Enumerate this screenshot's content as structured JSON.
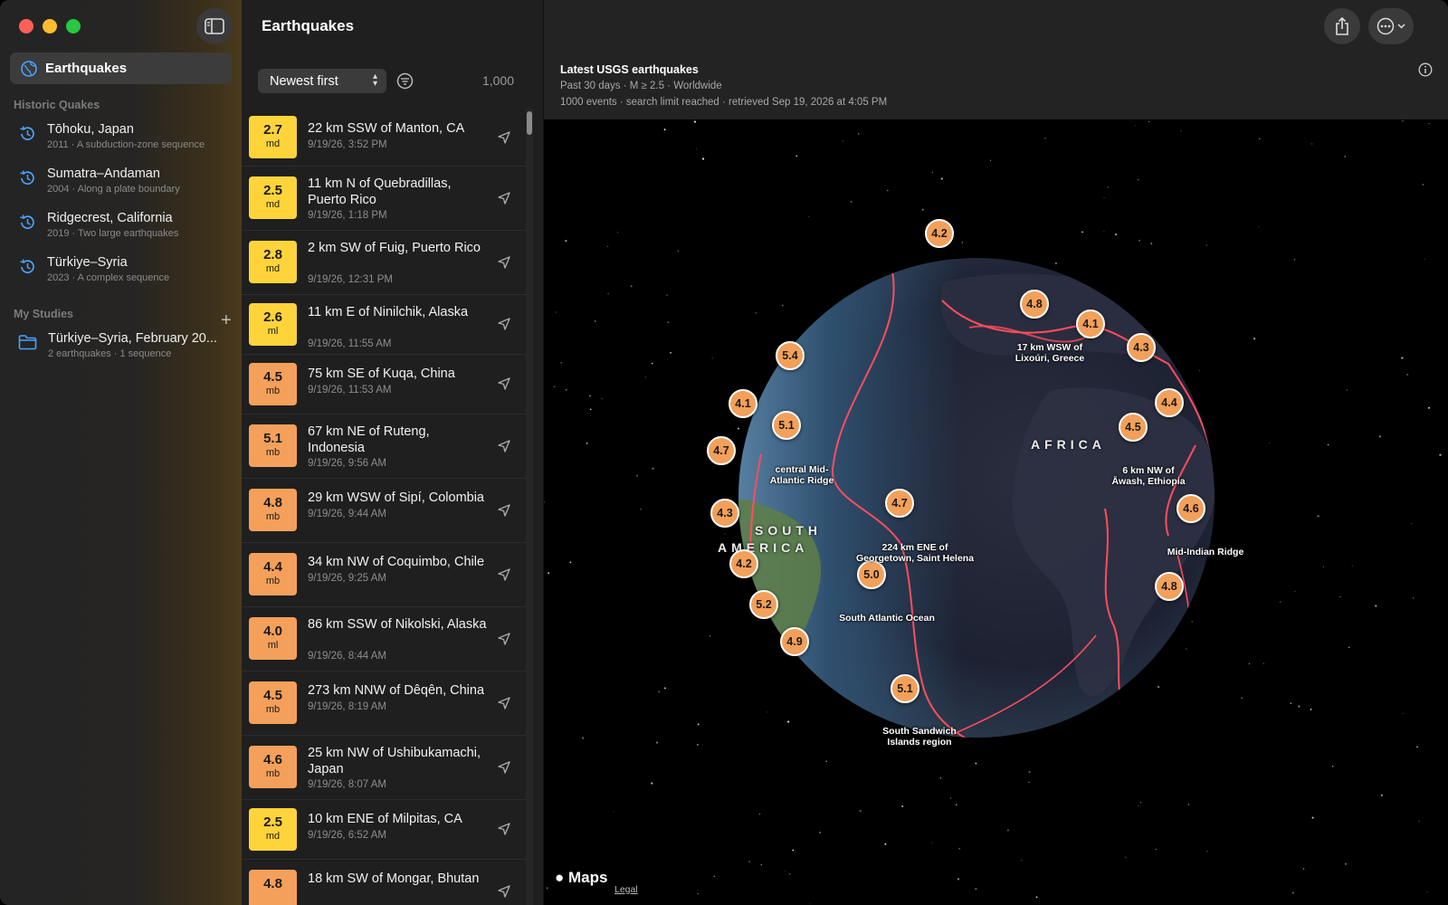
{
  "sidebar": {
    "selected": {
      "label": "Earthquakes"
    },
    "historic_header": "Historic Quakes",
    "historic": [
      {
        "title": "Tōhoku, Japan",
        "subtitle": "2011 · A subduction-zone sequence"
      },
      {
        "title": "Sumatra–Andaman",
        "subtitle": "2004 · Along a plate boundary"
      },
      {
        "title": "Ridgecrest, California",
        "subtitle": "2019 · Two large earthquakes"
      },
      {
        "title": "Türkiye–Syria",
        "subtitle": "2023 · A complex sequence"
      }
    ],
    "studies_header": "My Studies",
    "add_label": "+",
    "studies": [
      {
        "title": "Türkiye–Syria, February 20...",
        "subtitle": "2 earthquakes · 1 sequence"
      }
    ]
  },
  "list": {
    "title": "Earthquakes",
    "sort_label": "Newest first",
    "count": "1,000",
    "rows": [
      {
        "mag": "2.7",
        "unit": "md",
        "place": "22 km SSW of Manton, CA",
        "time": "9/19/26, 3:52 PM",
        "color": "#ffd43b"
      },
      {
        "mag": "2.5",
        "unit": "md",
        "place": "11 km N of Quebradillas, Puerto Rico",
        "time": "9/19/26, 1:18 PM",
        "color": "#ffd43b"
      },
      {
        "mag": "2.8",
        "unit": "md",
        "place": "2 km SW of Fuig, Puerto Rico",
        "time": "9/19/26, 12:31 PM",
        "color": "#ffd43b"
      },
      {
        "mag": "2.6",
        "unit": "ml",
        "place": "11 km E of Ninilchik, Alaska",
        "time": "9/19/26, 11:55 AM",
        "color": "#ffd43b"
      },
      {
        "mag": "4.5",
        "unit": "mb",
        "place": "75 km SE of Kuqa, China",
        "time": "9/19/26, 11:53 AM",
        "color": "#f5a05a"
      },
      {
        "mag": "5.1",
        "unit": "mb",
        "place": "67 km NE of Ruteng, Indonesia",
        "time": "9/19/26, 9:56 AM",
        "color": "#f5a05a"
      },
      {
        "mag": "4.8",
        "unit": "mb",
        "place": "29 km WSW of Sipí, Colombia",
        "time": "9/19/26, 9:44 AM",
        "color": "#f5a05a"
      },
      {
        "mag": "4.4",
        "unit": "mb",
        "place": "34 km NW of Coquimbo, Chile",
        "time": "9/19/26, 9:25 AM",
        "color": "#f5a05a"
      },
      {
        "mag": "4.0",
        "unit": "ml",
        "place": "86 km SSW of Nikolski, Alaska",
        "time": "9/19/26, 8:44 AM",
        "color": "#f5a05a"
      },
      {
        "mag": "4.5",
        "unit": "mb",
        "place": "273 km NNW of Dêqên, China",
        "time": "9/19/26, 8:19 AM",
        "color": "#f5a05a"
      },
      {
        "mag": "4.6",
        "unit": "mb",
        "place": "25 km NW of Ushibukamachi, Japan",
        "time": "9/19/26, 8:07 AM",
        "color": "#f5a05a"
      },
      {
        "mag": "2.5",
        "unit": "md",
        "place": "10 km ENE of Milpitas, CA",
        "time": "9/19/26, 6:52 AM",
        "color": "#ffd43b"
      },
      {
        "mag": "4.8",
        "unit": "",
        "place": "18 km SW of Mongar, Bhutan",
        "time": "",
        "color": "#f5a05a"
      }
    ]
  },
  "map": {
    "title": "Latest USGS earthquakes",
    "subtitle": "Past 30 days · M ≥ 2.5 · Worldwide",
    "info": "1000 events · search limit reached · retrieved Sep 19, 2026 at 4:05 PM",
    "continents": {
      "africa": "AFRICA",
      "south_america_1": "SOUTH",
      "south_america_2": "AMERICA"
    },
    "markers": [
      "4.2",
      "4.8",
      "4.1",
      "4.3",
      "5.4",
      "4.1",
      "5.1",
      "4.4",
      "4.5",
      "4.7",
      "4.7",
      "4.3",
      "4.6",
      "4.2",
      "5.0",
      "5.2",
      "4.8",
      "4.9",
      "5.1"
    ],
    "labels": [
      "17 km WSW of\nLixoúri, Greece",
      "central Mid-\nAtlantic Ridge",
      "6 km NW of\nĀwash, Ethiopia",
      "224 km ENE of\nGeorgetown, Saint Helena",
      "Mid-Indian Ridge",
      "South Atlantic Ocean",
      "South Sandwich\nIslands region"
    ],
    "brand": "Maps",
    "legal": "Legal",
    "colors": {
      "marker": "#f2a05a",
      "plate_boundary": "#ff4d5e",
      "mag_low": "#ffd43b",
      "mag_mid": "#f5a05a"
    }
  }
}
